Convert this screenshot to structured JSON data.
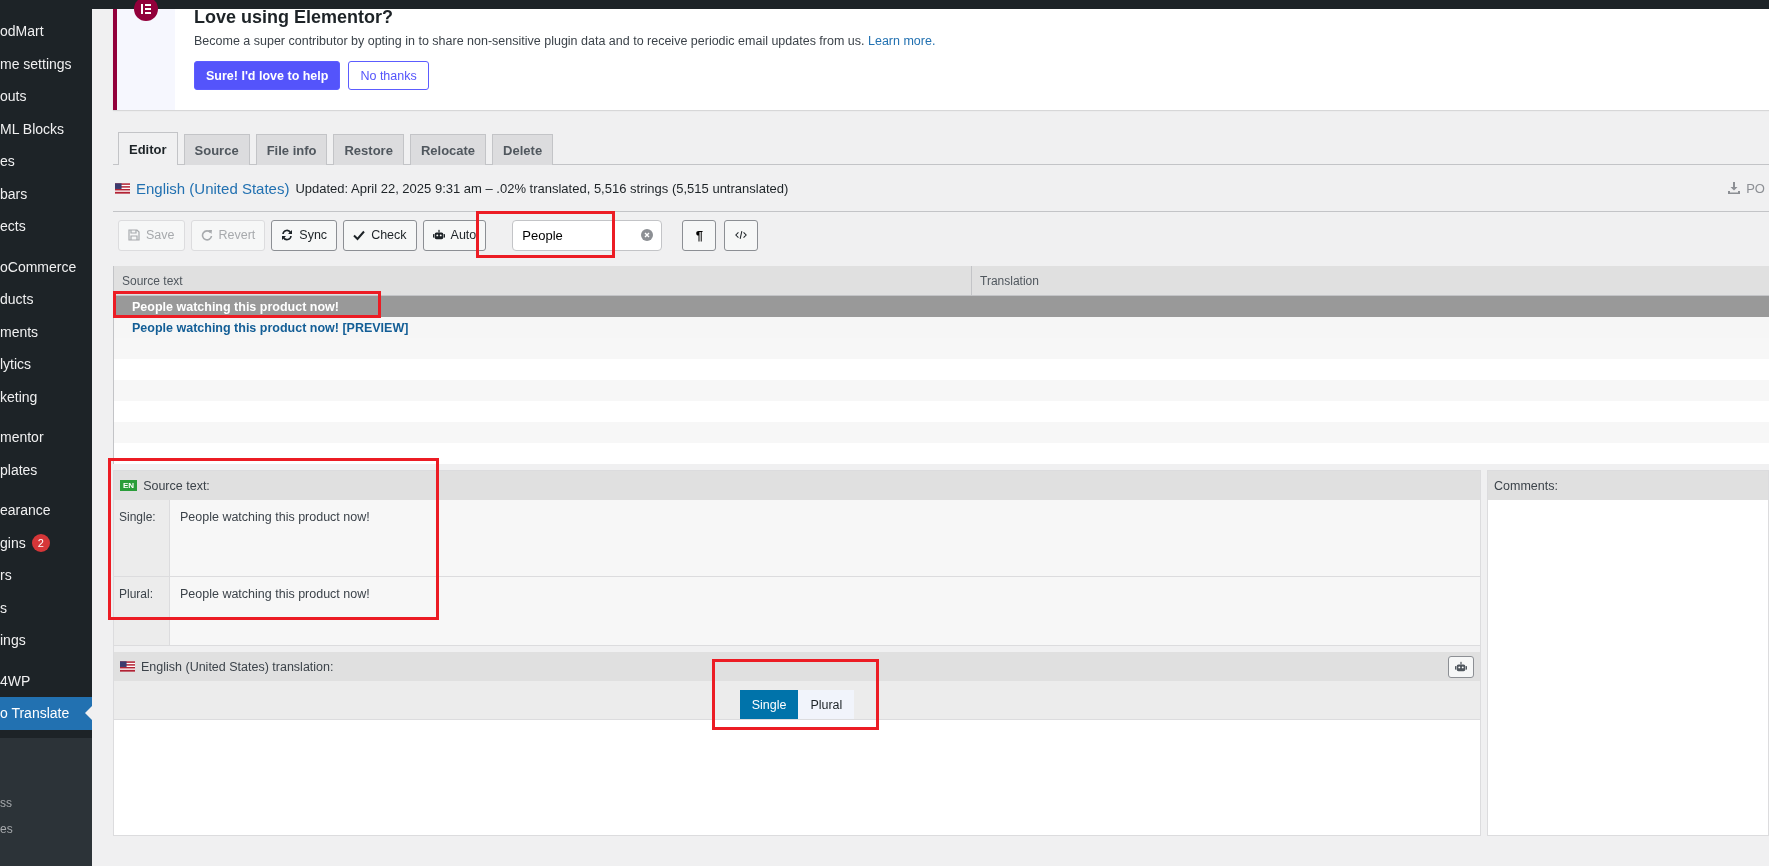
{
  "sidebar": {
    "groups": [
      {
        "items": [
          {
            "label": "odMart",
            "selected": false
          },
          {
            "label": "me settings",
            "selected": false
          },
          {
            "label": "outs",
            "selected": false
          },
          {
            "label": "ML Blocks",
            "selected": false
          },
          {
            "label": "es",
            "selected": false
          },
          {
            "label": "bars",
            "selected": false
          },
          {
            "label": "ects",
            "selected": false
          }
        ]
      },
      {
        "items": [
          {
            "label": "oCommerce",
            "selected": false
          },
          {
            "label": "ducts",
            "selected": false
          },
          {
            "label": "ments",
            "selected": false
          },
          {
            "label": "lytics",
            "selected": false
          },
          {
            "label": "keting",
            "selected": false
          }
        ]
      },
      {
        "items": [
          {
            "label": "mentor",
            "selected": false
          },
          {
            "label": "plates",
            "selected": false
          }
        ]
      },
      {
        "items": [
          {
            "label": "earance",
            "selected": false
          },
          {
            "label": "gins",
            "badge": "2",
            "selected": false
          },
          {
            "label": "rs",
            "selected": false
          },
          {
            "label": "s",
            "selected": false
          },
          {
            "label": "ings",
            "selected": false
          }
        ]
      },
      {
        "items": [
          {
            "label": "4WP",
            "selected": false
          },
          {
            "label": "o Translate",
            "selected": true
          }
        ]
      }
    ],
    "footer": [
      "ss",
      "es"
    ]
  },
  "notice": {
    "title": "Love using Elementor?",
    "text": "Become a super contributor by opting in to share non-sensitive plugin data and to receive periodic email updates from us.",
    "link": "Learn more.",
    "buttons": [
      {
        "label": "Sure! I'd love to help",
        "kind": "primary"
      },
      {
        "label": "No thanks",
        "kind": "secondary"
      }
    ]
  },
  "tabs": [
    {
      "label": "Editor",
      "selected": true
    },
    {
      "label": "Source",
      "selected": false
    },
    {
      "label": "File info",
      "selected": false
    },
    {
      "label": "Restore",
      "selected": false
    },
    {
      "label": "Relocate",
      "selected": false
    },
    {
      "label": "Delete",
      "selected": false
    }
  ],
  "locale": {
    "name": "English (United States)",
    "info": "Updated: April 22, 2025 9:31 am – .02% translated, 5,516 strings (5,515 untranslated)",
    "download": "PO"
  },
  "toolbar": {
    "buttons": [
      {
        "label": "Save",
        "kind": "save",
        "disabled": true
      },
      {
        "label": "Revert",
        "kind": "revert",
        "disabled": true
      },
      {
        "label": "Sync",
        "kind": "sync",
        "disabled": false
      },
      {
        "label": "Check",
        "kind": "check",
        "disabled": false
      },
      {
        "label": "Auto",
        "kind": "robot",
        "disabled": false
      }
    ],
    "search": {
      "value": "People"
    },
    "tools": [
      {
        "kind": "pilcrow",
        "label": "¶"
      },
      {
        "kind": "code"
      }
    ]
  },
  "table": {
    "columns": [
      "Source text",
      "Translation"
    ],
    "rows": [
      {
        "source": "People watching this product now!",
        "selected": true
      },
      {
        "source": "People watching this product now! [PREVIEW]",
        "selected": false
      }
    ]
  },
  "source_panel": {
    "badge": "EN",
    "title": "Source text:",
    "forms": [
      {
        "label": "Single:",
        "text": "People watching this product now!"
      },
      {
        "label": "Plural:",
        "text": "People watching this product now!"
      }
    ]
  },
  "comments": {
    "title": "Comments:"
  },
  "translation": {
    "title": "English (United States) translation:",
    "tabs": [
      {
        "label": "Single",
        "selected": true
      },
      {
        "label": "Plural",
        "selected": false
      }
    ]
  }
}
